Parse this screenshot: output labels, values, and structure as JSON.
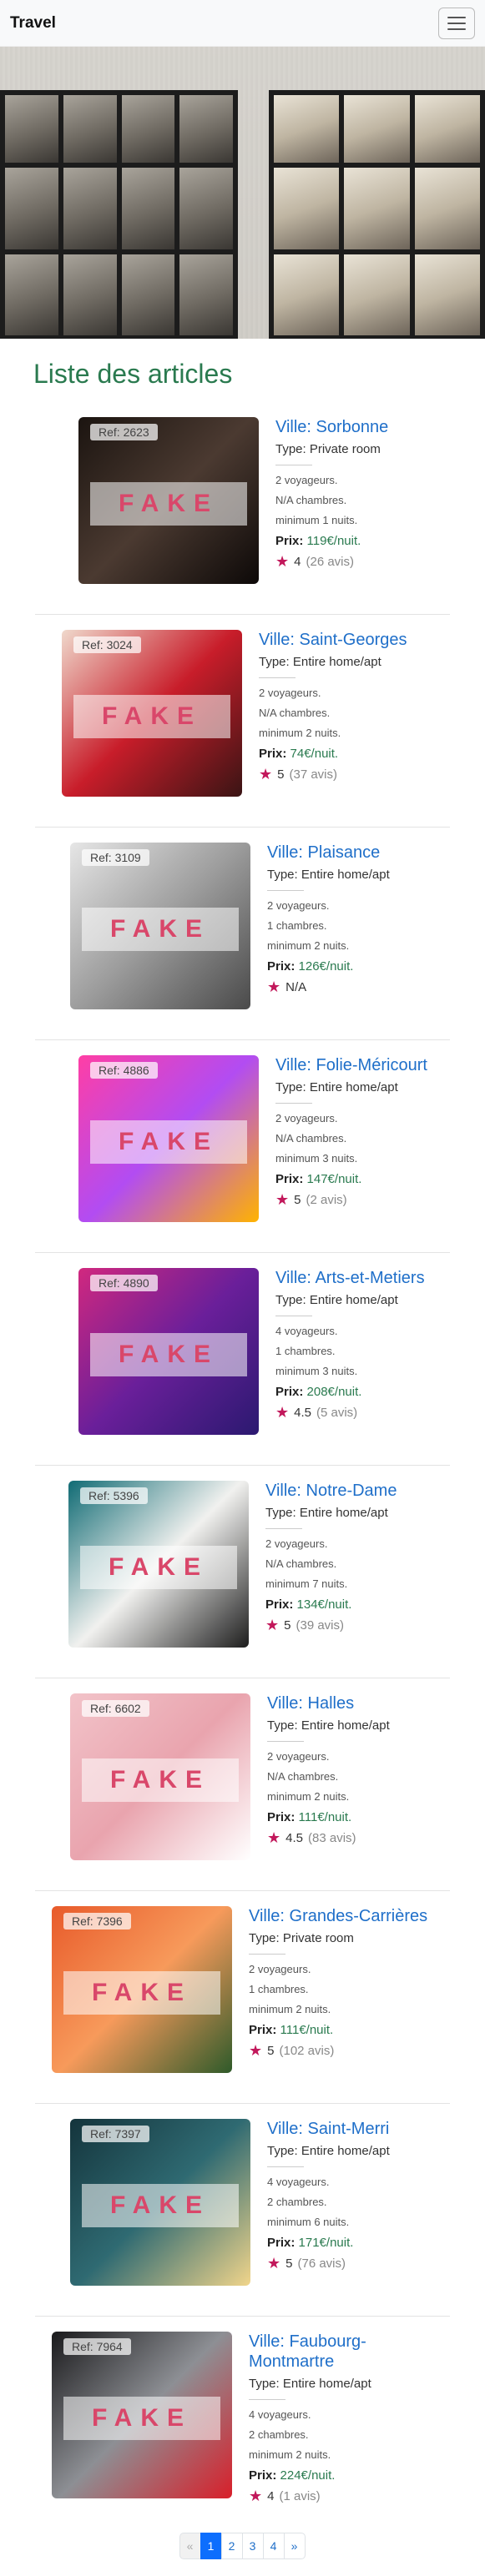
{
  "navbar": {
    "brand": "Travel"
  },
  "page_title": "Liste des articles",
  "watermark": "FAKE",
  "price_label": "Prix:",
  "articles": [
    {
      "ref": "Ref: 2623",
      "city": "Ville: Sorbonne",
      "type": "Type: Private room",
      "travelers": "2 voyageurs.",
      "rooms": "N/A chambres.",
      "nights": "minimum 1 nuits.",
      "price": "119€/nuit.",
      "rating": "4",
      "reviews": "(26 avis)",
      "colors": [
        "#1b1410",
        "#4b3a31",
        "#0d0908"
      ]
    },
    {
      "ref": "Ref: 3024",
      "city": "Ville: Saint-Georges",
      "type": "Type: Entire home/apt",
      "travelers": "2 voyageurs.",
      "rooms": "N/A chambres.",
      "nights": "minimum 2 nuits.",
      "price": "74€/nuit.",
      "rating": "5",
      "reviews": "(37 avis)",
      "colors": [
        "#f0d9cc",
        "#c81d2a",
        "#3a1414"
      ]
    },
    {
      "ref": "Ref: 3109",
      "city": "Ville: Plaisance",
      "type": "Type: Entire home/apt",
      "travelers": "2 voyageurs.",
      "rooms": "1 chambres.",
      "nights": "minimum 2 nuits.",
      "price": "126€/nuit.",
      "rating": "N/A",
      "reviews": "",
      "colors": [
        "#e6e6e6",
        "#9c9c9c",
        "#4a4a4a"
      ]
    },
    {
      "ref": "Ref: 4886",
      "city": "Ville: Folie-Méricourt",
      "type": "Type: Entire home/apt",
      "travelers": "2 voyageurs.",
      "rooms": "N/A chambres.",
      "nights": "minimum 3 nuits.",
      "price": "147€/nuit.",
      "rating": "5",
      "reviews": "(2 avis)",
      "colors": [
        "#ff3ea5",
        "#b24cf2",
        "#ffb300"
      ]
    },
    {
      "ref": "Ref: 4890",
      "city": "Ville: Arts-et-Metiers",
      "type": "Type: Entire home/apt",
      "travelers": "4 voyageurs.",
      "rooms": "1 chambres.",
      "nights": "minimum 3 nuits.",
      "price": "208€/nuit.",
      "rating": "4.5",
      "reviews": "(5 avis)",
      "colors": [
        "#d1287f",
        "#6a1f9a",
        "#2b1970"
      ]
    },
    {
      "ref": "Ref: 5396",
      "city": "Ville: Notre-Dame",
      "type": "Type: Entire home/apt",
      "travelers": "2 voyageurs.",
      "rooms": "N/A chambres.",
      "nights": "minimum 7 nuits.",
      "price": "134€/nuit.",
      "rating": "5",
      "reviews": "(39 avis)",
      "colors": [
        "#106b74",
        "#f1f1ef",
        "#1d1d1d"
      ]
    },
    {
      "ref": "Ref: 6602",
      "city": "Ville: Halles",
      "type": "Type: Entire home/apt",
      "travelers": "2 voyageurs.",
      "rooms": "N/A chambres.",
      "nights": "minimum 2 nuits.",
      "price": "111€/nuit.",
      "rating": "4.5",
      "reviews": "(83 avis)",
      "colors": [
        "#f2c3c9",
        "#e9a4ae",
        "#ffffff"
      ]
    },
    {
      "ref": "Ref: 7396",
      "city": "Ville: Grandes-Carrières",
      "type": "Type: Private room",
      "travelers": "2 voyageurs.",
      "rooms": "1 chambres.",
      "nights": "minimum 2 nuits.",
      "price": "111€/nuit.",
      "rating": "5",
      "reviews": "(102 avis)",
      "colors": [
        "#e85a2a",
        "#f79a5b",
        "#2e5a2a"
      ]
    },
    {
      "ref": "Ref: 7397",
      "city": "Ville: Saint-Merri",
      "type": "Type: Entire home/apt",
      "travelers": "4 voyageurs.",
      "rooms": "2 chambres.",
      "nights": "minimum 6 nuits.",
      "price": "171€/nuit.",
      "rating": "5",
      "reviews": "(76 avis)",
      "colors": [
        "#14343c",
        "#2f6a72",
        "#f1d58b"
      ]
    },
    {
      "ref": "Ref: 7964",
      "city": "Ville: Faubourg-Montmartre",
      "type": "Type: Entire home/apt",
      "travelers": "4 voyageurs.",
      "rooms": "2 chambres.",
      "nights": "minimum 2 nuits.",
      "price": "224€/nuit.",
      "rating": "4",
      "reviews": "(1 avis)",
      "colors": [
        "#1a1a1c",
        "#8d8f94",
        "#d81f2a"
      ]
    }
  ],
  "pagination": {
    "prev": "«",
    "pages": [
      "1",
      "2",
      "3",
      "4"
    ],
    "next": "»",
    "active": "1"
  }
}
